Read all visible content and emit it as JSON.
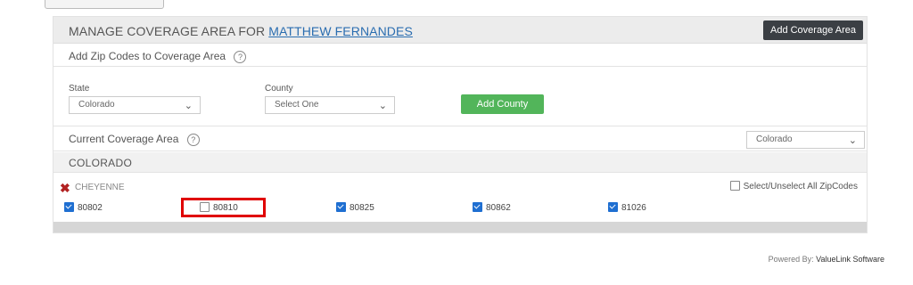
{
  "header": {
    "title_prefix": "MANAGE COVERAGE AREA FOR",
    "agent_name": "MATTHEW FERNANDES",
    "add_coverage_label": "Add Coverage Area"
  },
  "zip_section": {
    "label": "Add Zip Codes to Coverage Area",
    "help": "?"
  },
  "form": {
    "state_label": "State",
    "state_value": "Colorado",
    "county_label": "County",
    "county_value": "Select One",
    "add_county_label": "Add County"
  },
  "current_section": {
    "label": "Current Coverage Area",
    "help": "?",
    "filter_value": "Colorado"
  },
  "state_heading": "COLORADO",
  "county": {
    "name": "CHEYENNE",
    "select_all_label": "Select/Unselect All ZipCodes"
  },
  "zips": [
    {
      "code": "80802",
      "checked": true
    },
    {
      "code": "80810",
      "checked": false
    },
    {
      "code": "80825",
      "checked": true
    },
    {
      "code": "80862",
      "checked": true
    },
    {
      "code": "81026",
      "checked": true
    }
  ],
  "footer": {
    "prefix": "Powered By:",
    "brand": "ValueLink Software"
  },
  "colors": {
    "add_county_button": "#52b55a",
    "add_area_button": "#3b3f44",
    "remove_icon": "#b22222",
    "highlight": "#e00000",
    "link": "#2a6db0"
  },
  "icons": {
    "help": "help-circle-icon",
    "chevron": "chevron-down-icon",
    "remove": "remove-x-icon"
  }
}
